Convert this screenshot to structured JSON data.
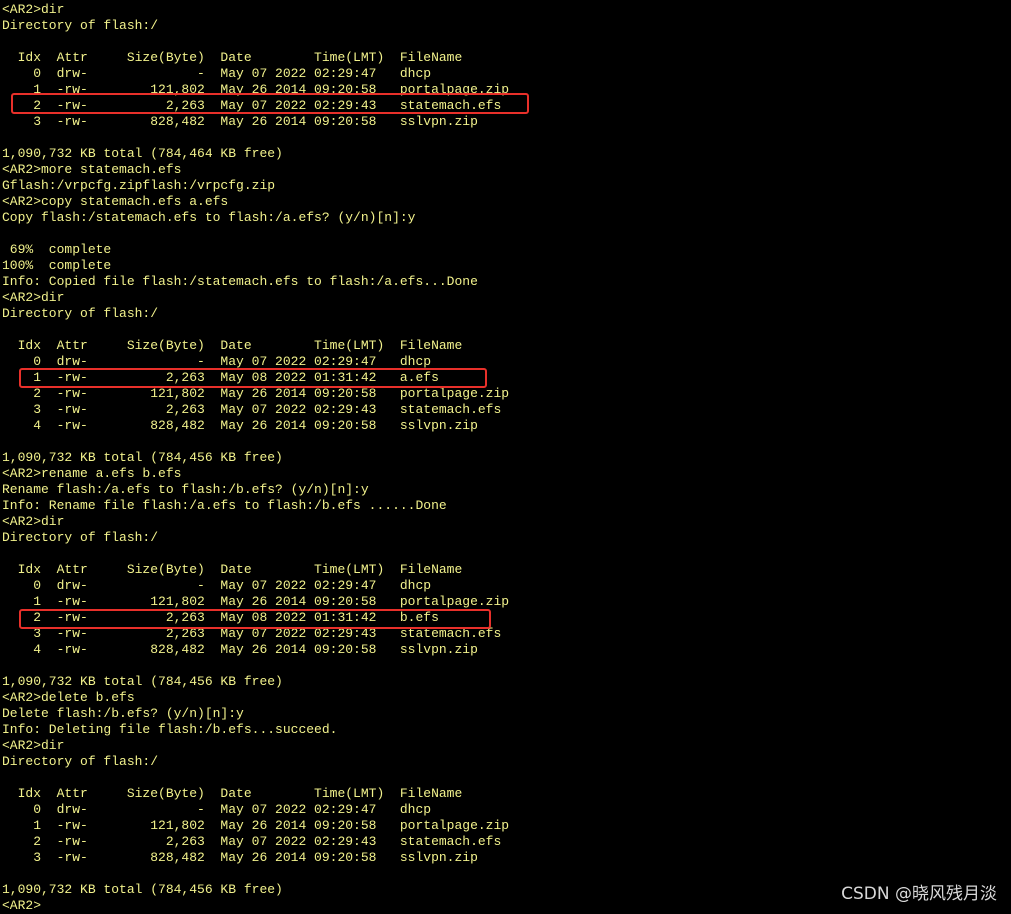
{
  "terminal": {
    "text_color": "#f2f28c",
    "background": "#000000",
    "highlight_color": "#e8302a",
    "lines": [
      "<AR2>dir",
      "Directory of flash:/",
      "",
      "  Idx  Attr     Size(Byte)  Date        Time(LMT)  FileName",
      "    0  drw-              -  May 07 2022 02:29:47   dhcp",
      "    1  -rw-        121,802  May 26 2014 09:20:58   portalpage.zip",
      "    2  -rw-          2,263  May 07 2022 02:29:43   statemach.efs",
      "    3  -rw-        828,482  May 26 2014 09:20:58   sslvpn.zip",
      "",
      "1,090,732 KB total (784,464 KB free)",
      "<AR2>more statemach.efs",
      "Gflash:/vrpcfg.zipflash:/vrpcfg.zip",
      "<AR2>copy statemach.efs a.efs",
      "Copy flash:/statemach.efs to flash:/a.efs? (y/n)[n]:y",
      "",
      " 69%  complete",
      "100%  complete",
      "Info: Copied file flash:/statemach.efs to flash:/a.efs...Done",
      "<AR2>dir",
      "Directory of flash:/",
      "",
      "  Idx  Attr     Size(Byte)  Date        Time(LMT)  FileName",
      "    0  drw-              -  May 07 2022 02:29:47   dhcp",
      "    1  -rw-          2,263  May 08 2022 01:31:42   a.efs",
      "    2  -rw-        121,802  May 26 2014 09:20:58   portalpage.zip",
      "    3  -rw-          2,263  May 07 2022 02:29:43   statemach.efs",
      "    4  -rw-        828,482  May 26 2014 09:20:58   sslvpn.zip",
      "",
      "1,090,732 KB total (784,456 KB free)",
      "<AR2>rename a.efs b.efs",
      "Rename flash:/a.efs to flash:/b.efs? (y/n)[n]:y",
      "Info: Rename file flash:/a.efs to flash:/b.efs ......Done",
      "<AR2>dir",
      "Directory of flash:/",
      "",
      "  Idx  Attr     Size(Byte)  Date        Time(LMT)  FileName",
      "    0  drw-              -  May 07 2022 02:29:47   dhcp",
      "    1  -rw-        121,802  May 26 2014 09:20:58   portalpage.zip",
      "    2  -rw-          2,263  May 08 2022 01:31:42   b.efs",
      "    3  -rw-          2,263  May 07 2022 02:29:43   statemach.efs",
      "    4  -rw-        828,482  May 26 2014 09:20:58   sslvpn.zip",
      "",
      "1,090,732 KB total (784,456 KB free)",
      "<AR2>delete b.efs",
      "Delete flash:/b.efs? (y/n)[n]:y",
      "Info: Deleting file flash:/b.efs...succeed.",
      "<AR2>dir",
      "Directory of flash:/",
      "",
      "  Idx  Attr     Size(Byte)  Date        Time(LMT)  FileName",
      "    0  drw-              -  May 07 2022 02:29:47   dhcp",
      "    1  -rw-        121,802  May 26 2014 09:20:58   portalpage.zip",
      "    2  -rw-          2,263  May 07 2022 02:29:43   statemach.efs",
      "    3  -rw-        828,482  May 26 2014 09:20:58   sslvpn.zip",
      "",
      "1,090,732 KB total (784,456 KB free)",
      "<AR2>"
    ]
  },
  "watermark": "CSDN @晓风残月淡"
}
